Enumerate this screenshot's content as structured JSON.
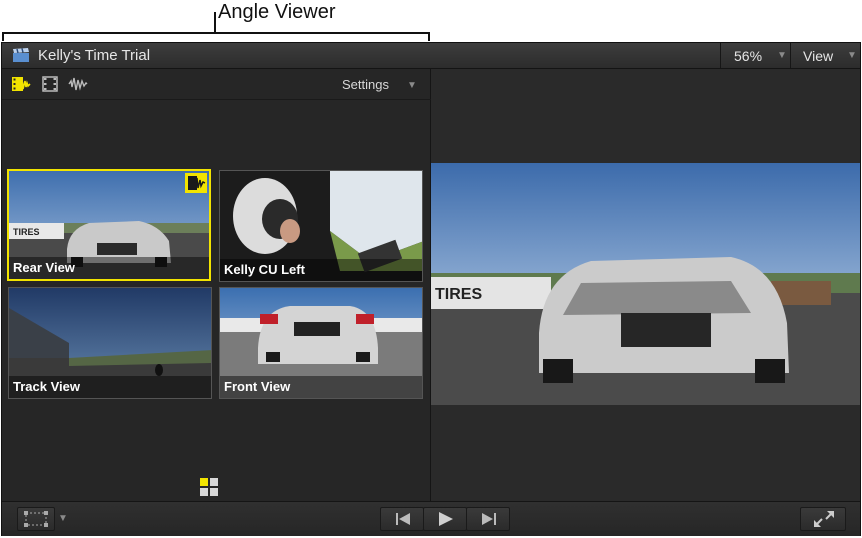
{
  "callout": {
    "label": "Angle Viewer"
  },
  "window": {
    "title": "Kelly's Time Trial",
    "zoom": "56%",
    "view_menu": "View"
  },
  "toolbar": {
    "settings_label": "Settings",
    "icons": [
      "video-audio-switch-icon",
      "video-only-switch-icon",
      "audio-only-switch-icon"
    ]
  },
  "angles": [
    {
      "label": "Rear View",
      "active": true
    },
    {
      "label": "Kelly CU Left",
      "active": false
    },
    {
      "label": "Track View",
      "active": false
    },
    {
      "label": "Front View",
      "active": false
    }
  ],
  "scene_text": {
    "banner": "TIRES"
  },
  "bottombar": {
    "icons": [
      "transform-icon",
      "previous-icon",
      "play-icon",
      "next-icon",
      "fullscreen-icon"
    ]
  },
  "colors": {
    "active_angle": "#f2e400",
    "window_bg": "#282828"
  }
}
